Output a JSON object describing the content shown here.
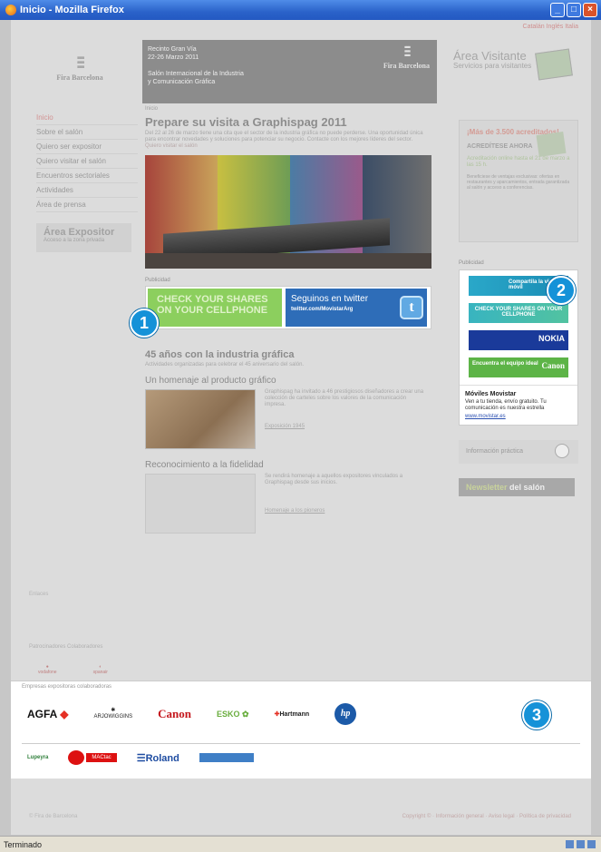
{
  "window": {
    "title": "Inicio - Mozilla Firefox",
    "status": "Terminado"
  },
  "toplinks": "Catalán  Inglés  Italia",
  "header": {
    "logo_text": "Fira Barcelona",
    "banner_lines": [
      "Recinto Gran Vía",
      "22-26 Marzo 2011",
      "",
      "Salón Internacional de la Industria",
      "y Comunicación Gráfica"
    ],
    "banner_brand": "Fira Barcelona",
    "visit_title": "Área Visitante",
    "visit_sub": "Servicios para visitantes"
  },
  "nav": [
    "Inicio",
    "Sobre el salón",
    "Quiero ser expositor",
    "Quiero visitar el salón",
    "Encuentros sectoriales",
    "Actividades",
    "Área de prensa"
  ],
  "area_expositor": {
    "title": "Área Expositor",
    "sub": "Acceso a la zona privada"
  },
  "main": {
    "breadcrumb": "Inicio",
    "title": "Prepare su visita a Graphispag 2011",
    "intro": "Del 22 al 26 de marzo tiene una cita que el sector de la industria gráfica no puede perderse. Una oportunidad única para encontrar novedades y soluciones para potenciar su negocio. Contacte con los mejores líderes del sector.",
    "intro_link": "Quiero visitar el salón",
    "publicidad": "Publicidad",
    "ad_green": "CHECK YOUR SHARES ON YOUR CELLPHONE",
    "ad_twitter_a": "Seguinos en twitter",
    "ad_twitter_b": "twitter.com/MovistarArg",
    "section_title": "45 años con la industria gráfica",
    "section_sub": "Actividades organizadas para celebrar el 45 aniversario del salón.",
    "s1_title": "Un homenaje al producto gráfico",
    "s1_text": "Graphispag ha invitado a 46 prestigiosos diseñadores a crear una colección de carteles sobre los valores de la comunicación impresa.",
    "s1_link": "Exposición 1945",
    "s2_title": "Reconocimiento a la fidelidad",
    "s2_text": "Se rendirá homenaje a aquellos expositores vinculados a Graphispag desde sus inicios.",
    "s2_link": "Homenaje a los pioneros"
  },
  "right": {
    "acred_red": "¡Más de 3.500 acreditados!",
    "acred_bold": "ACREDÍTESE AHORA",
    "acred_green": "Acreditación online hasta el 21 de marzo a las 15 h.",
    "acred_small": "Beneficiese de ventajas exclusivas: ofertas en restaurantes y aparcamientos, entrada garantizada al salón y acceso a conferencias.",
    "publicidad": "Publicidad",
    "ad1": "Compartila la vida es móvil",
    "ad2": "CHECK YOUR SHARES ON YOUR CELLPHONE",
    "ad3": "NOKIA",
    "ad4a": "Encuentra el equipo ideal",
    "ad4b": "Canon",
    "mm_title": "Móviles Movistar",
    "mm_desc": "Ven a tu tienda, envío gratuito. Tu comunicación es nuestra estrella",
    "mm_url": "www.movistar.es",
    "info": "Información práctica",
    "newsletter_a": "Newsletter",
    "newsletter_b": " del salón"
  },
  "footer": {
    "links": "Enlaces",
    "sponsors_head": "Patrocinadores     Colaboradores",
    "collab_head": "Empresas expositoras colaboradoras",
    "logos1": [
      "AGFA",
      "ARJOWIGGINS",
      "Canon",
      "ESKO",
      "Hartmann",
      "hp"
    ],
    "logos2": [
      "Lupeyra",
      "MACtac",
      "Roland",
      ""
    ],
    "copyright": "© Fira de Barcelona",
    "legal": "Copyright © · Información general · Aviso legal · Política de privacidad"
  },
  "badges": [
    "1",
    "2",
    "3"
  ]
}
